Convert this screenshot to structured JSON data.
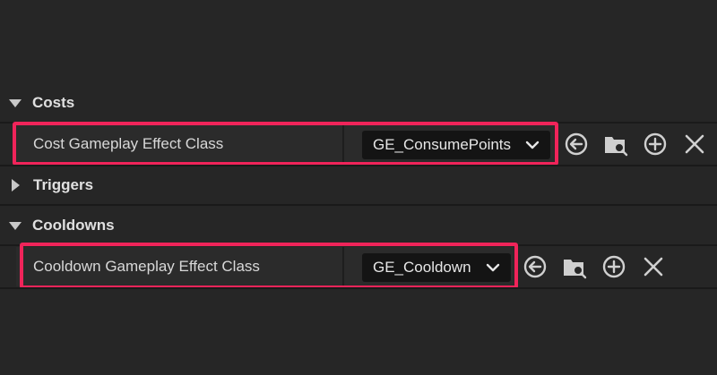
{
  "sections": {
    "costs": {
      "title": "Costs"
    },
    "triggers": {
      "title": "Triggers"
    },
    "cooldowns": {
      "title": "Cooldowns"
    }
  },
  "properties": {
    "cost": {
      "label": "Cost Gameplay Effect Class",
      "value": "GE_ConsumePoints"
    },
    "cooldown": {
      "label": "Cooldown Gameplay Effect Class",
      "value": "GE_Cooldown"
    }
  },
  "colors": {
    "background": "#262626",
    "highlight": "#f0245a",
    "combo_bg": "#141414"
  },
  "icons": [
    "use-selected-icon",
    "browse-asset-icon",
    "add-icon",
    "clear-icon"
  ]
}
